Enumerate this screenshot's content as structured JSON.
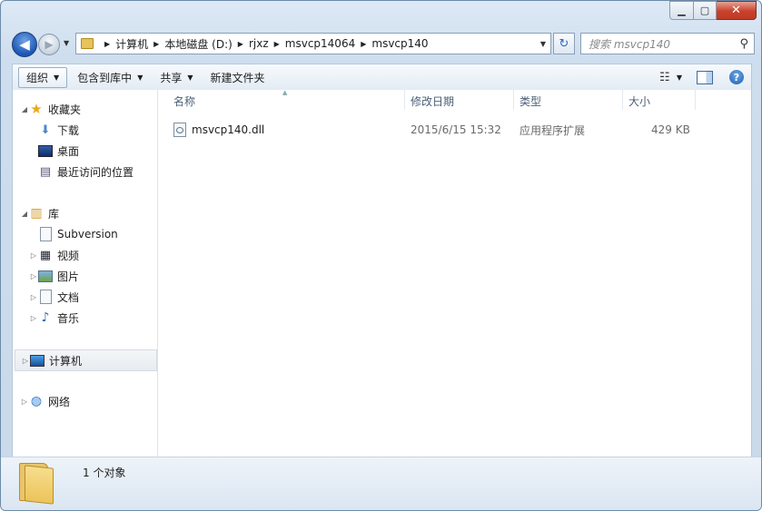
{
  "window": {
    "controls": {
      "minimize": "▁",
      "maximize": "▢",
      "close": "✕"
    }
  },
  "nav": {
    "back_icon": "◀",
    "forward_icon": "▶",
    "history_dropdown": "▼",
    "breadcrumb": [
      "计算机",
      "本地磁盘 (D:)",
      "rjxz",
      "msvcp14064",
      "msvcp140"
    ],
    "address_dropdown": "▼",
    "refresh_icon": "↻",
    "search_placeholder": "搜索 msvcp140",
    "search_icon": "⚲"
  },
  "toolbar": {
    "organize": "组织",
    "include_in_library": "包含到库中",
    "share": "共享",
    "new_folder": "新建文件夹",
    "arrow": "▼",
    "view_icon": "☷",
    "help_icon": "?"
  },
  "sidebar": {
    "favorites": {
      "label": "收藏夹",
      "items": [
        "下载",
        "桌面",
        "最近访问的位置"
      ]
    },
    "libraries": {
      "label": "库",
      "items": [
        "Subversion",
        "视频",
        "图片",
        "文档",
        "音乐"
      ]
    },
    "computer": {
      "label": "计算机"
    },
    "network": {
      "label": "网络"
    },
    "expanded": "◢",
    "collapsed": "▷"
  },
  "columns": {
    "name": "名称",
    "modified": "修改日期",
    "type": "类型",
    "size": "大小",
    "sort_indicator": "▲"
  },
  "files": [
    {
      "name": "msvcp140.dll",
      "modified": "2015/6/15 15:32",
      "type": "应用程序扩展",
      "size": "429 KB"
    }
  ],
  "details": {
    "count": "1 个对象"
  },
  "colors": {
    "accent": "#1c56b3",
    "close": "#c8412b",
    "frame": "#cfdeee"
  }
}
